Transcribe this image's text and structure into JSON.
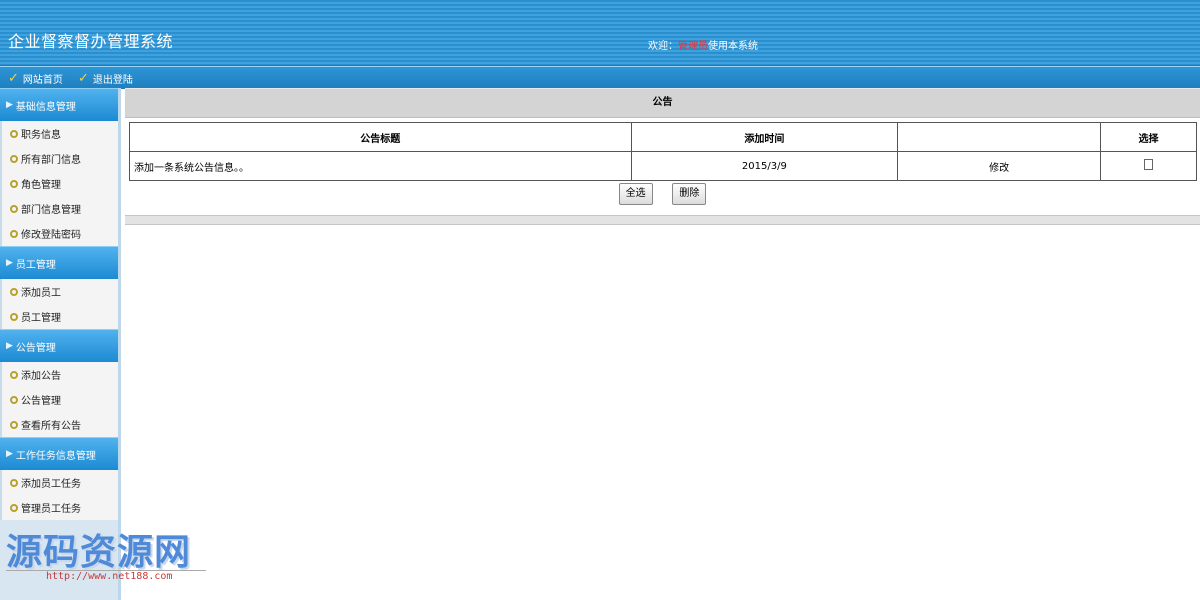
{
  "header": {
    "title": "企业督察督办管理系统",
    "welcome_prefix": "欢迎：",
    "admin_name": "管理员",
    "welcome_suffix": "使用本系统"
  },
  "topnav": {
    "home": "网站首页",
    "logout": "退出登陆"
  },
  "sidebar": {
    "groups": [
      {
        "label": "基础信息管理",
        "items": [
          "职务信息",
          "所有部门信息",
          "角色管理",
          "部门信息管理",
          "修改登陆密码"
        ]
      },
      {
        "label": "员工管理",
        "items": [
          "添加员工",
          "员工管理"
        ]
      },
      {
        "label": "公告管理",
        "items": [
          "添加公告",
          "公告管理",
          "查看所有公告"
        ]
      },
      {
        "label": "工作任务信息管理",
        "items": [
          "添加员工任务",
          "管理员工任务"
        ]
      }
    ]
  },
  "main": {
    "section_title": "公告",
    "columns": [
      "公告标题",
      "添加时间",
      "",
      "选择"
    ],
    "rows": [
      {
        "title": "添加一条系统公告信息。。",
        "time": "2015/3/9",
        "action": "修改"
      }
    ],
    "select_all": "全选",
    "delete": "删除"
  },
  "watermark": {
    "text": "源码资源网",
    "url": "http://www.net188.com"
  }
}
